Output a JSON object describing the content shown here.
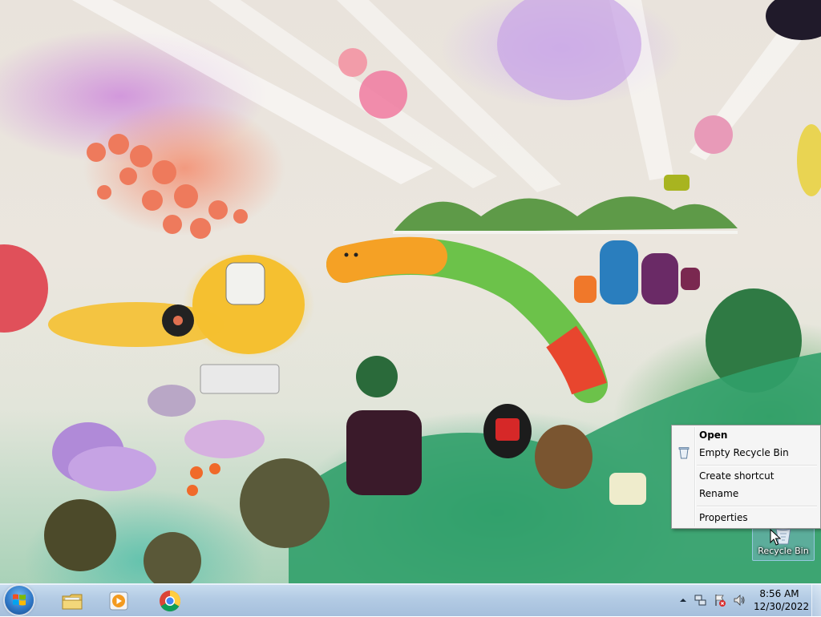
{
  "desktop": {
    "icons": [
      {
        "label": "Recycle Bin",
        "icon": "recycle-bin-icon"
      }
    ]
  },
  "context_menu": {
    "items": [
      {
        "label": "Open",
        "bold": true
      },
      {
        "label": "Empty Recycle Bin",
        "icon": "empty-recycle-bin-icon"
      },
      {
        "label": "Create shortcut"
      },
      {
        "label": "Rename"
      },
      {
        "label": "Properties"
      }
    ]
  },
  "taskbar": {
    "start_icon": "windows-start-orb-icon",
    "pinned": [
      {
        "icon": "file-explorer-icon"
      },
      {
        "icon": "windows-media-player-icon"
      },
      {
        "icon": "google-chrome-icon"
      }
    ],
    "tray": {
      "icons": [
        "show-hidden-icons-icon",
        "network-icon",
        "action-center-flag-icon",
        "volume-icon"
      ],
      "time": "8:56 AM",
      "date": "12/30/2022"
    }
  },
  "colors": {
    "taskbar": "#b3cbe4",
    "menu_background": "#f5f5f5",
    "selection": "#96bee6"
  }
}
